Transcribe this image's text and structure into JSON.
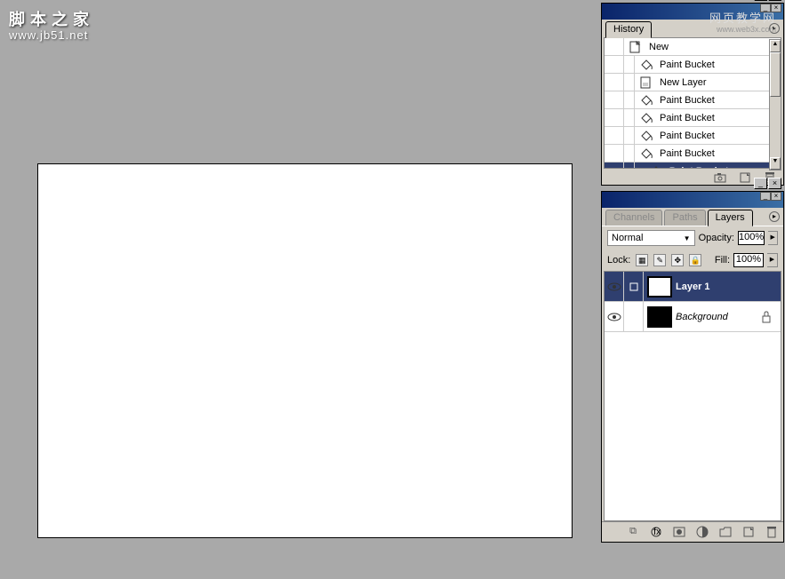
{
  "watermarks": {
    "cn": "脚本之家",
    "url": "www.jb51.net",
    "cn2": "网页教学网",
    "url2": "www.web3x.com"
  },
  "canvas": {},
  "history": {
    "tab": "History",
    "items": [
      {
        "icon": "new",
        "label": "New"
      },
      {
        "icon": "bucket",
        "label": "Paint Bucket"
      },
      {
        "icon": "newlayer",
        "label": "New Layer"
      },
      {
        "icon": "bucket",
        "label": "Paint Bucket"
      },
      {
        "icon": "bucket",
        "label": "Paint Bucket"
      },
      {
        "icon": "bucket",
        "label": "Paint Bucket"
      },
      {
        "icon": "bucket",
        "label": "Paint Bucket"
      },
      {
        "icon": "bucket",
        "label": "Paint Bucket",
        "selected": true
      }
    ]
  },
  "layers": {
    "tabs": {
      "channels": "Channels",
      "paths": "Paths",
      "layers": "Layers"
    },
    "blend": "Normal",
    "opacity_label": "Opacity:",
    "opacity": "100%",
    "lock_label": "Lock:",
    "fill_label": "Fill:",
    "fill": "100%",
    "items": [
      {
        "name": "Layer 1",
        "thumb": "white",
        "selected": true,
        "locked": false
      },
      {
        "name": "Background",
        "thumb": "black",
        "selected": false,
        "locked": true
      }
    ]
  }
}
